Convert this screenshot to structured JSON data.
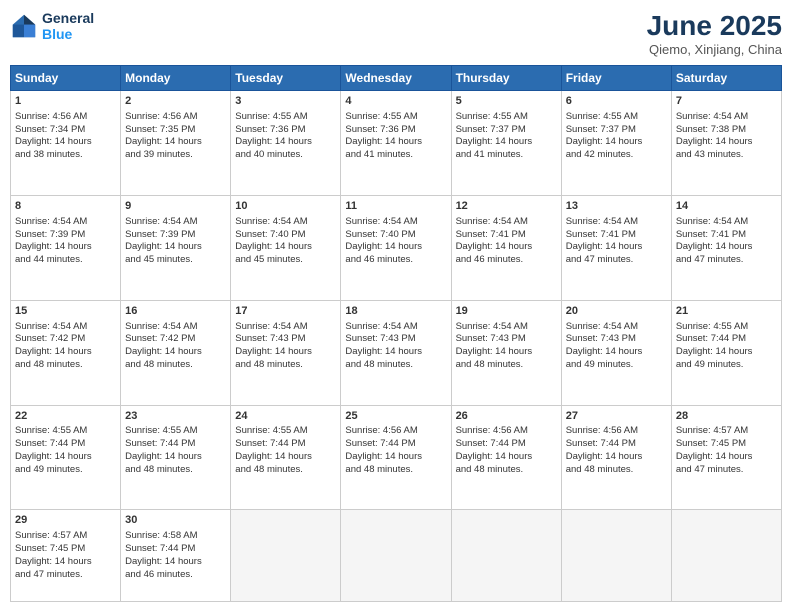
{
  "header": {
    "logo_line1": "General",
    "logo_line2": "Blue",
    "month_title": "June 2025",
    "location": "Qiemo, Xinjiang, China"
  },
  "weekdays": [
    "Sunday",
    "Monday",
    "Tuesday",
    "Wednesday",
    "Thursday",
    "Friday",
    "Saturday"
  ],
  "weeks": [
    [
      {
        "day": 1,
        "info": "Sunrise: 4:56 AM\nSunset: 7:34 PM\nDaylight: 14 hours\nand 38 minutes."
      },
      {
        "day": 2,
        "info": "Sunrise: 4:56 AM\nSunset: 7:35 PM\nDaylight: 14 hours\nand 39 minutes."
      },
      {
        "day": 3,
        "info": "Sunrise: 4:55 AM\nSunset: 7:36 PM\nDaylight: 14 hours\nand 40 minutes."
      },
      {
        "day": 4,
        "info": "Sunrise: 4:55 AM\nSunset: 7:36 PM\nDaylight: 14 hours\nand 41 minutes."
      },
      {
        "day": 5,
        "info": "Sunrise: 4:55 AM\nSunset: 7:37 PM\nDaylight: 14 hours\nand 41 minutes."
      },
      {
        "day": 6,
        "info": "Sunrise: 4:55 AM\nSunset: 7:37 PM\nDaylight: 14 hours\nand 42 minutes."
      },
      {
        "day": 7,
        "info": "Sunrise: 4:54 AM\nSunset: 7:38 PM\nDaylight: 14 hours\nand 43 minutes."
      }
    ],
    [
      {
        "day": 8,
        "info": "Sunrise: 4:54 AM\nSunset: 7:39 PM\nDaylight: 14 hours\nand 44 minutes."
      },
      {
        "day": 9,
        "info": "Sunrise: 4:54 AM\nSunset: 7:39 PM\nDaylight: 14 hours\nand 45 minutes."
      },
      {
        "day": 10,
        "info": "Sunrise: 4:54 AM\nSunset: 7:40 PM\nDaylight: 14 hours\nand 45 minutes."
      },
      {
        "day": 11,
        "info": "Sunrise: 4:54 AM\nSunset: 7:40 PM\nDaylight: 14 hours\nand 46 minutes."
      },
      {
        "day": 12,
        "info": "Sunrise: 4:54 AM\nSunset: 7:41 PM\nDaylight: 14 hours\nand 46 minutes."
      },
      {
        "day": 13,
        "info": "Sunrise: 4:54 AM\nSunset: 7:41 PM\nDaylight: 14 hours\nand 47 minutes."
      },
      {
        "day": 14,
        "info": "Sunrise: 4:54 AM\nSunset: 7:41 PM\nDaylight: 14 hours\nand 47 minutes."
      }
    ],
    [
      {
        "day": 15,
        "info": "Sunrise: 4:54 AM\nSunset: 7:42 PM\nDaylight: 14 hours\nand 48 minutes."
      },
      {
        "day": 16,
        "info": "Sunrise: 4:54 AM\nSunset: 7:42 PM\nDaylight: 14 hours\nand 48 minutes."
      },
      {
        "day": 17,
        "info": "Sunrise: 4:54 AM\nSunset: 7:43 PM\nDaylight: 14 hours\nand 48 minutes."
      },
      {
        "day": 18,
        "info": "Sunrise: 4:54 AM\nSunset: 7:43 PM\nDaylight: 14 hours\nand 48 minutes."
      },
      {
        "day": 19,
        "info": "Sunrise: 4:54 AM\nSunset: 7:43 PM\nDaylight: 14 hours\nand 48 minutes."
      },
      {
        "day": 20,
        "info": "Sunrise: 4:54 AM\nSunset: 7:43 PM\nDaylight: 14 hours\nand 49 minutes."
      },
      {
        "day": 21,
        "info": "Sunrise: 4:55 AM\nSunset: 7:44 PM\nDaylight: 14 hours\nand 49 minutes."
      }
    ],
    [
      {
        "day": 22,
        "info": "Sunrise: 4:55 AM\nSunset: 7:44 PM\nDaylight: 14 hours\nand 49 minutes."
      },
      {
        "day": 23,
        "info": "Sunrise: 4:55 AM\nSunset: 7:44 PM\nDaylight: 14 hours\nand 48 minutes."
      },
      {
        "day": 24,
        "info": "Sunrise: 4:55 AM\nSunset: 7:44 PM\nDaylight: 14 hours\nand 48 minutes."
      },
      {
        "day": 25,
        "info": "Sunrise: 4:56 AM\nSunset: 7:44 PM\nDaylight: 14 hours\nand 48 minutes."
      },
      {
        "day": 26,
        "info": "Sunrise: 4:56 AM\nSunset: 7:44 PM\nDaylight: 14 hours\nand 48 minutes."
      },
      {
        "day": 27,
        "info": "Sunrise: 4:56 AM\nSunset: 7:44 PM\nDaylight: 14 hours\nand 48 minutes."
      },
      {
        "day": 28,
        "info": "Sunrise: 4:57 AM\nSunset: 7:45 PM\nDaylight: 14 hours\nand 47 minutes."
      }
    ],
    [
      {
        "day": 29,
        "info": "Sunrise: 4:57 AM\nSunset: 7:45 PM\nDaylight: 14 hours\nand 47 minutes."
      },
      {
        "day": 30,
        "info": "Sunrise: 4:58 AM\nSunset: 7:44 PM\nDaylight: 14 hours\nand 46 minutes."
      },
      {
        "day": null,
        "info": ""
      },
      {
        "day": null,
        "info": ""
      },
      {
        "day": null,
        "info": ""
      },
      {
        "day": null,
        "info": ""
      },
      {
        "day": null,
        "info": ""
      }
    ]
  ]
}
